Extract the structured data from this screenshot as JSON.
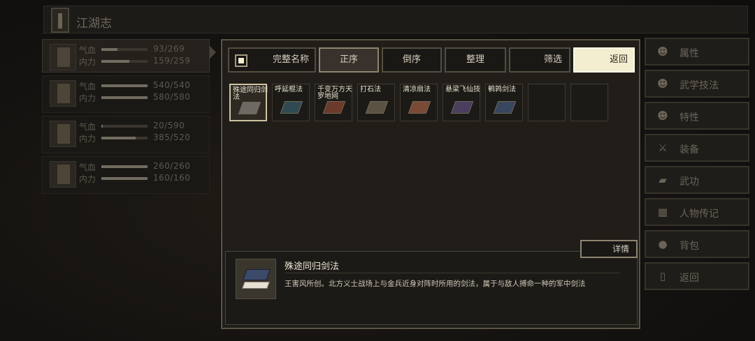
{
  "header": {
    "title": "江湖志"
  },
  "party": [
    {
      "hp_label": "气血",
      "hp_value": "93/269",
      "hp_fill": 0.35,
      "mp_label": "内力",
      "mp_value": "159/259",
      "mp_fill": 0.61
    },
    {
      "hp_label": "气血",
      "hp_value": "540/540",
      "hp_fill": 1.0,
      "mp_label": "内力",
      "mp_value": "580/580",
      "mp_fill": 1.0
    },
    {
      "hp_label": "气血",
      "hp_value": "20/590",
      "hp_fill": 0.03,
      "mp_label": "内力",
      "mp_value": "385/520",
      "mp_fill": 0.74
    },
    {
      "hp_label": "气血",
      "hp_value": "260/260",
      "hp_fill": 1.0,
      "mp_label": "内力",
      "mp_value": "160/160",
      "mp_fill": 1.0
    }
  ],
  "toolbar": {
    "fullname_label": "完整名称",
    "ascending_label": "正序",
    "descending_label": "倒序",
    "organize_label": "整理",
    "filter_label": "筛选",
    "return_label": "返回"
  },
  "skills": [
    {
      "name": "殊途同归剑法",
      "color": "#6d6a63",
      "selected": true
    },
    {
      "name": "呼延棍法",
      "color": "#2f4a52"
    },
    {
      "name": "千变万方天罗地网",
      "color": "#6b3a2b"
    },
    {
      "name": "打石法",
      "color": "#5b5243"
    },
    {
      "name": "清凉扇法",
      "color": "#7a4a36"
    },
    {
      "name": "悬梁飞仙技",
      "color": "#4b3d5e"
    },
    {
      "name": "鹌鹑剑法",
      "color": "#38465e"
    },
    {
      "name": "",
      "color": ""
    },
    {
      "name": "",
      "color": ""
    }
  ],
  "detail": {
    "button_label": "详情",
    "name": "殊途同归剑法",
    "description": "王害风所创。北方义士战场上与金兵近身对阵时所用的剑法，属于与敌人搏命一种的军中剑法"
  },
  "side_menu": [
    {
      "label": "属性",
      "icon": "person-icon",
      "glyph": "☻"
    },
    {
      "label": "武学技法",
      "icon": "martial-icon",
      "glyph": "☻"
    },
    {
      "label": "特性",
      "icon": "trait-icon",
      "glyph": "☻"
    },
    {
      "label": "装备",
      "icon": "sword-icon",
      "glyph": "⚔"
    },
    {
      "label": "武功",
      "icon": "book-icon",
      "glyph": "▰"
    },
    {
      "label": "人物传记",
      "icon": "biography-icon",
      "glyph": "▦"
    },
    {
      "label": "背包",
      "icon": "bag-icon",
      "glyph": "●"
    },
    {
      "label": "返回",
      "icon": "door-icon",
      "glyph": "▯"
    }
  ]
}
